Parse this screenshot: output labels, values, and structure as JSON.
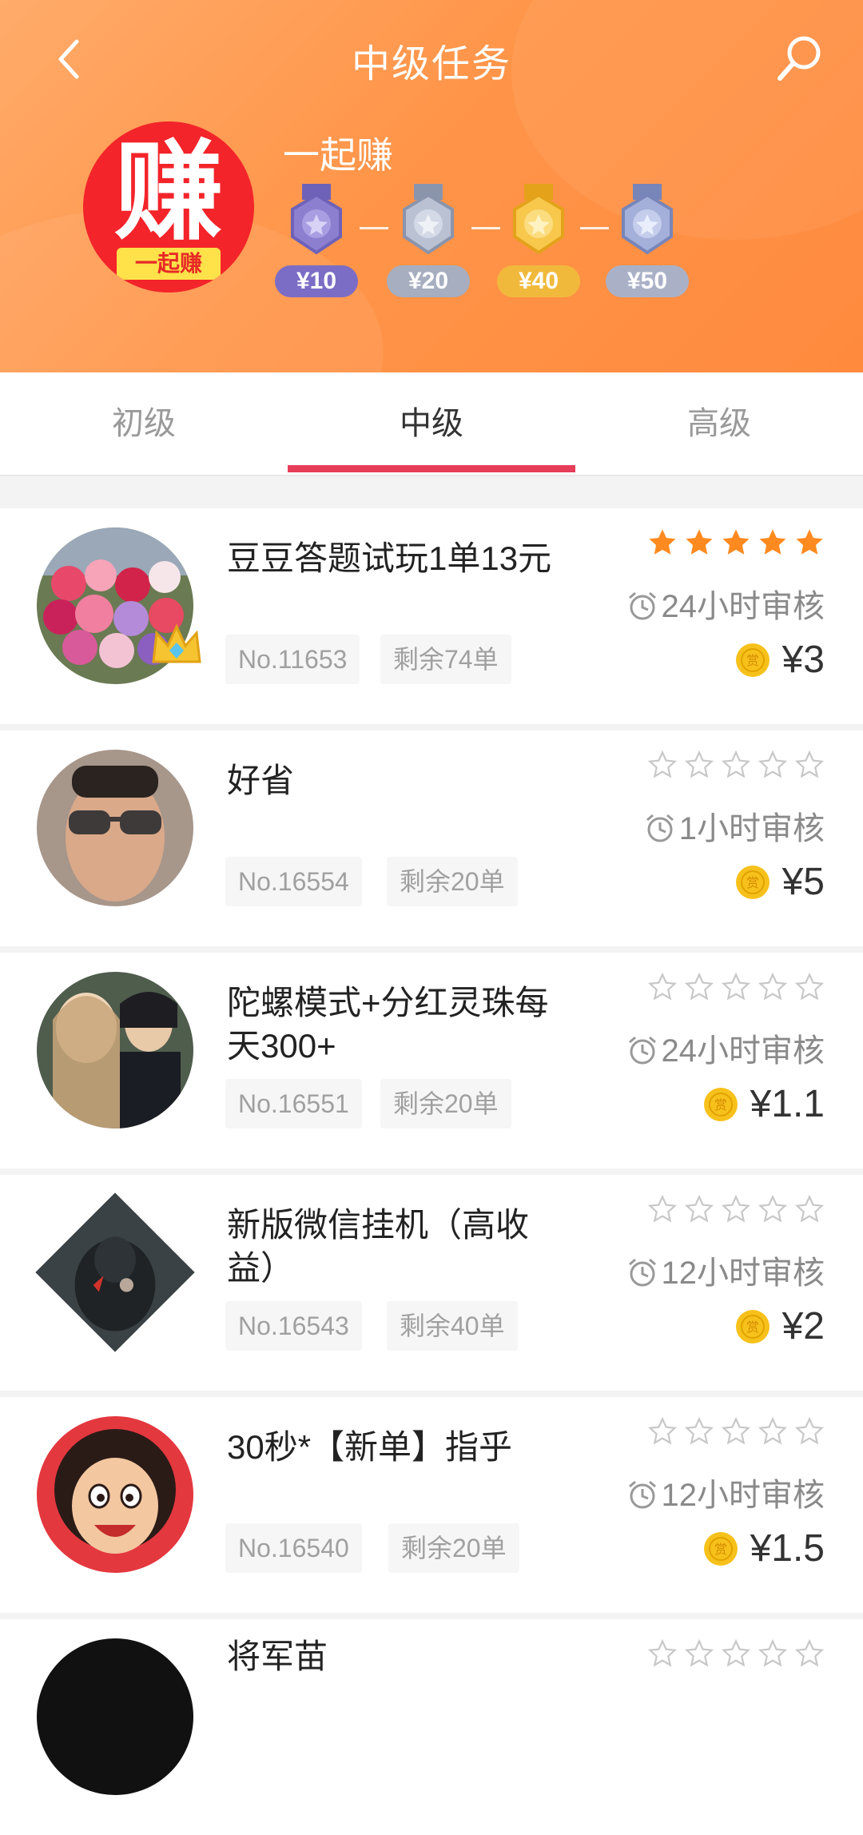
{
  "nav": {
    "title": "中级任务",
    "back_icon": "chevron-left-icon",
    "search_icon": "search-icon"
  },
  "brand": {
    "logo_char": "赚",
    "logo_ribbon": "一起赚",
    "name": "一起赚"
  },
  "medals": [
    {
      "label": "¥10",
      "color": "#8c7fd0"
    },
    {
      "label": "¥20",
      "color": "#a6b0c6"
    },
    {
      "label": "¥40",
      "color": "#f5c24a"
    },
    {
      "label": "¥50",
      "color": "#9aa7d2"
    }
  ],
  "tabs": [
    {
      "label": "初级",
      "active": false
    },
    {
      "label": "中级",
      "active": true
    },
    {
      "label": "高级",
      "active": false
    }
  ],
  "tasks": [
    {
      "title": "豆豆答题试玩1单13元",
      "number": "No.11653",
      "remaining": "剩余74单",
      "rating": 5,
      "review": "24小时审核",
      "price": "¥3",
      "avatar": "flowers-avatar",
      "badge": "crown"
    },
    {
      "title": "好省",
      "number": "No.16554",
      "remaining": "剩余20单",
      "rating": 0,
      "review": "1小时审核",
      "price": "¥5",
      "avatar": "man-sunglasses-avatar"
    },
    {
      "title": "陀螺模式+分红灵珠每天300+",
      "number": "No.16551",
      "remaining": "剩余20单",
      "rating": 0,
      "review": "24小时审核",
      "price": "¥1.1",
      "avatar": "anime-avatar"
    },
    {
      "title": "新版微信挂机（高收益）",
      "number": "No.16543",
      "remaining": "剩余40单",
      "rating": 0,
      "review": "12小时审核",
      "price": "¥2",
      "avatar": "hooded-figure-avatar"
    },
    {
      "title": "30秒*【新单】指乎",
      "number": "No.16540",
      "remaining": "剩余20单",
      "rating": 0,
      "review": "12小时审核",
      "price": "¥1.5",
      "avatar": "cartoon-face-avatar"
    },
    {
      "title": "将军苗",
      "number": "",
      "remaining": "",
      "rating": 0,
      "review": "",
      "price": "",
      "avatar": "dark-avatar"
    }
  ],
  "colors": {
    "header": "#ff9549",
    "tab_indicator": "#e63e58",
    "star_filled": "#ff8a1f",
    "star_empty": "#c8c8c8",
    "coin": "#f7c11b"
  }
}
